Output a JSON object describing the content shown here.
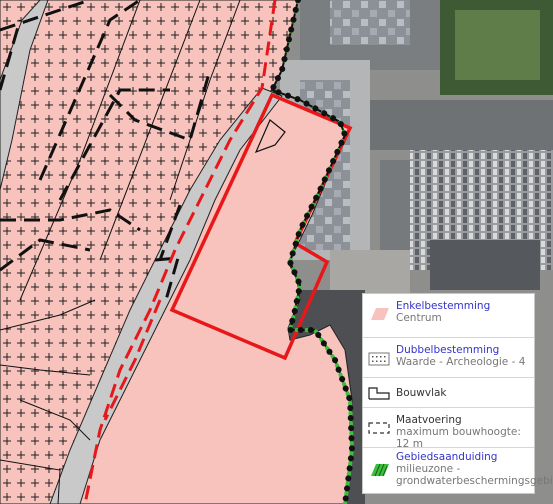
{
  "colors": {
    "enkelbestemming_centrum": "#f7c3bc",
    "road": "#c9c9c9",
    "selection_outline": "#e8171a",
    "gebiedsaanduiding": "#3ac03a",
    "legend_title": "#3333cc"
  },
  "legend": {
    "items": [
      {
        "title": "Enkelbestemming",
        "subtitle": "Centrum",
        "symbol": "pink-fill-icon"
      },
      {
        "title": "Dubbelbestemming",
        "subtitle": "Waarde - Archeologie - 4",
        "symbol": "dotted-box-icon"
      },
      {
        "label": "Bouwvlak",
        "symbol": "bouwvlak-outline-icon"
      },
      {
        "label": "Maatvoering",
        "subtitle": "maximum bouwhoogte: 12 m",
        "symbol": "dashed-box-icon"
      },
      {
        "title": "Gebiedsaanduiding",
        "subtitle": "milieuzone - grondwaterbeschermingsgebied",
        "symbol": "green-hatch-icon"
      }
    ]
  }
}
